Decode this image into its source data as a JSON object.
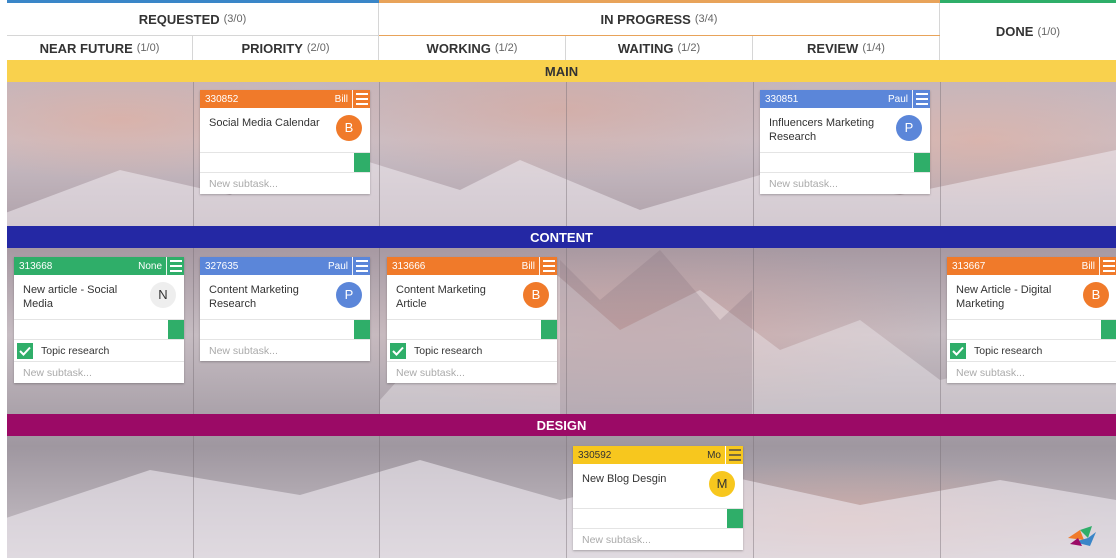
{
  "header": {
    "groups": [
      {
        "label": "REQUESTED",
        "count": "(3/0)",
        "color": "#3a86c8"
      },
      {
        "label": "IN PROGRESS",
        "count": "(3/4)",
        "color": "#e8a35a"
      },
      {
        "label": "DONE",
        "count": "(1/0)",
        "color": "#2fae69"
      }
    ],
    "columns": [
      {
        "label": "NEAR FUTURE",
        "count": "(1/0)"
      },
      {
        "label": "PRIORITY",
        "count": "(2/0)"
      },
      {
        "label": "WORKING",
        "count": "(1/2)"
      },
      {
        "label": "WAITING",
        "count": "(1/2)"
      },
      {
        "label": "REVIEW",
        "count": "(1/4)"
      }
    ]
  },
  "lanes": [
    {
      "label": "MAIN",
      "color": "#f9d14d"
    },
    {
      "label": "CONTENT",
      "color": "#2428a4"
    },
    {
      "label": "DESIGN",
      "color": "#9b0a66"
    }
  ],
  "cards": [
    {
      "id": "330852",
      "owner": "Bill",
      "title": "Social Media Calendar",
      "avatar": "B",
      "color": "#f07a2a",
      "avatar_color": "#f07a2a",
      "subtasks": [],
      "new_subtask": "New subtask..."
    },
    {
      "id": "330851",
      "owner": "Paul",
      "title": "Influencers Marketing Research",
      "avatar": "P",
      "color": "#5b86d9",
      "avatar_color": "#5b86d9",
      "subtasks": [],
      "new_subtask": "New subtask..."
    },
    {
      "id": "313668",
      "owner": "None",
      "title": "New article - Social Media",
      "avatar": "N",
      "color": "#2fae69",
      "avatar_color": "#eeeeee",
      "subtasks": [
        "Topic research"
      ],
      "new_subtask": "New subtask..."
    },
    {
      "id": "327635",
      "owner": "Paul",
      "title": "Content Marketing Research",
      "avatar": "P",
      "color": "#5b86d9",
      "avatar_color": "#5b86d9",
      "subtasks": [],
      "new_subtask": "New subtask..."
    },
    {
      "id": "313666",
      "owner": "Bill",
      "title": "Content Marketing Article",
      "avatar": "B",
      "color": "#f07a2a",
      "avatar_color": "#f07a2a",
      "subtasks": [
        "Topic research"
      ],
      "new_subtask": "New subtask..."
    },
    {
      "id": "313667",
      "owner": "Bill",
      "title": "New Article - Digital Marketing",
      "avatar": "B",
      "color": "#f07a2a",
      "avatar_color": "#f07a2a",
      "subtasks": [
        "Topic research"
      ],
      "new_subtask": "New subtask..."
    },
    {
      "id": "330592",
      "owner": "Mo",
      "title": "New Blog Desgin",
      "avatar": "M",
      "color": "#f7c71e",
      "avatar_color": "#f7c71e",
      "subtasks": [],
      "new_subtask": "New subtask..."
    }
  ],
  "icons": {
    "card_menu": "hamburger-menu-icon",
    "subtask_done": "checkmark-icon",
    "brand": "app-logo-icon"
  }
}
